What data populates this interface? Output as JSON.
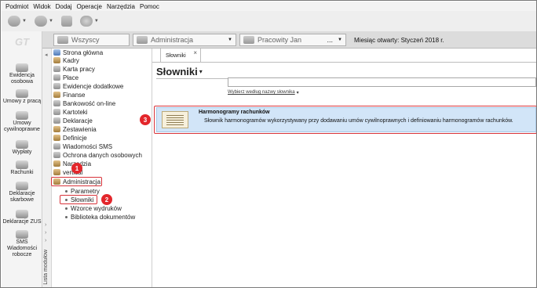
{
  "menu": [
    "Podmiot",
    "Widok",
    "Dodaj",
    "Operacje",
    "Narzędzia",
    "Pomoc"
  ],
  "toolbar": {
    "buttons": [
      {
        "name": "back-button",
        "icon": "back-arrow-icon"
      },
      {
        "name": "forward-button",
        "icon": "forward-arrow-icon"
      },
      {
        "name": "database-button",
        "icon": "database-icon"
      },
      {
        "name": "help-button",
        "icon": "help-icon"
      }
    ]
  },
  "context": {
    "all_label": "Wszyscy",
    "admin_label": "Administracja",
    "employees_label": "Pracowity Jan",
    "employees_more": "...",
    "month_label": "Miesiąc otwarty: Styczeń 2018 r."
  },
  "modules": [
    {
      "label": "Ewidencja osobowa",
      "icon": "people-icon"
    },
    {
      "label": "Umowy z pracą",
      "icon": "contract-icon"
    },
    {
      "label": "Umowy cywilnoprawne",
      "icon": "contract-icon"
    },
    {
      "label": "Wypłaty",
      "icon": "cash-icon"
    },
    {
      "label": "Rachunki",
      "icon": "bill-icon"
    },
    {
      "label": "Deklaracje skarbowe",
      "icon": "tax-icon"
    },
    {
      "label": "Deklaracje ZUS",
      "icon": "zus-icon"
    },
    {
      "label": "SMS Wiadomości robocze",
      "icon": "sms-icon"
    }
  ],
  "tree": {
    "side_label": "Lista modułów",
    "items": [
      "Strona główna",
      "Kadry",
      "Karta pracy",
      "Płace",
      "Ewidencje dodatkowe",
      "Finanse",
      "Bankowość on-line",
      "Kartoteki",
      "Deklaracje",
      "Zestawienia",
      "Definicje",
      "Wiadomości SMS",
      "Ochrona danych osobowych",
      "Narzędzia",
      "vertical",
      "Administracja"
    ],
    "subitems": [
      "Parametry",
      "Słowniki",
      "Wzorce wydruków",
      "Biblioteka dokumentów"
    ]
  },
  "tab": {
    "label": "Słowniki"
  },
  "content": {
    "title": "Słowniki",
    "search_placeholder": "",
    "search_note": "Wybierz według nazwy słownika"
  },
  "rows": [
    {
      "title": "Harmonogramy rachunków",
      "description": "Słownik harmonogramów wykorzystywany przy dodawaniu umów cywilnoprawnych i definiowaniu harmonogramów rachunków."
    }
  ],
  "badges": [
    "1",
    "2",
    "3"
  ],
  "colors": {
    "highlight": "#d8333a",
    "selected_row": "#d2e5f8",
    "badge": "#e3262b"
  }
}
